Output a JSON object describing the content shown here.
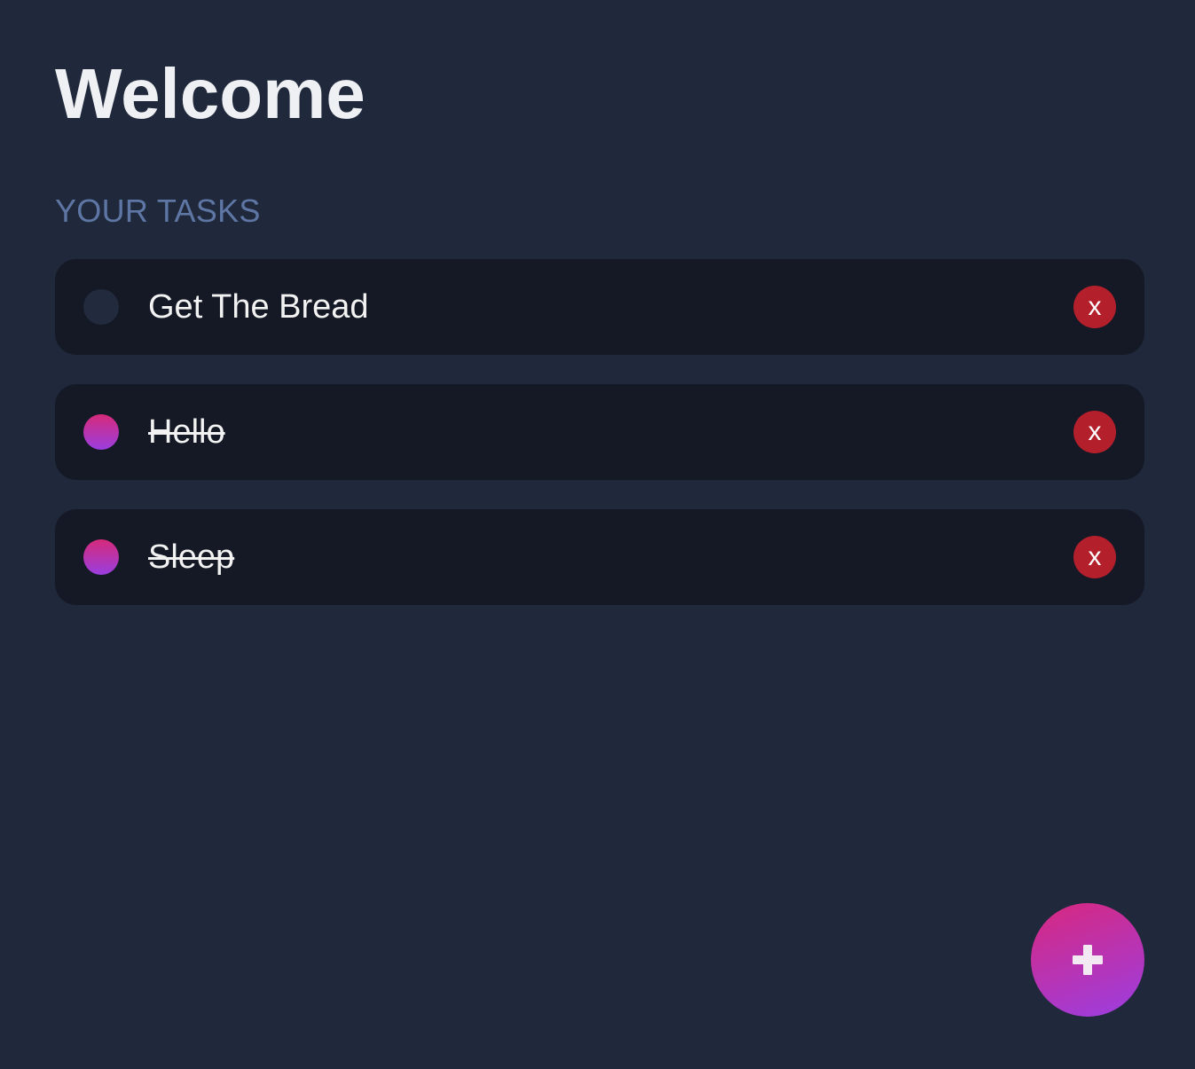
{
  "header": {
    "title": "Welcome"
  },
  "tasks_section": {
    "label": "YOUR TASKS",
    "items": [
      {
        "label": "Get The Bread",
        "done": false,
        "delete_label": "x"
      },
      {
        "label": "Hello",
        "done": true,
        "delete_label": "x"
      },
      {
        "label": "Sleep",
        "done": true,
        "delete_label": "x"
      }
    ]
  },
  "add_button": {
    "icon": "plus-icon"
  },
  "colors": {
    "background": "#20293c",
    "card": "#141925",
    "accent_gradient_start": "#d62a7a",
    "accent_gradient_end": "#9a3ee0",
    "delete": "#b41f2c",
    "section_label": "#5e76a4"
  }
}
